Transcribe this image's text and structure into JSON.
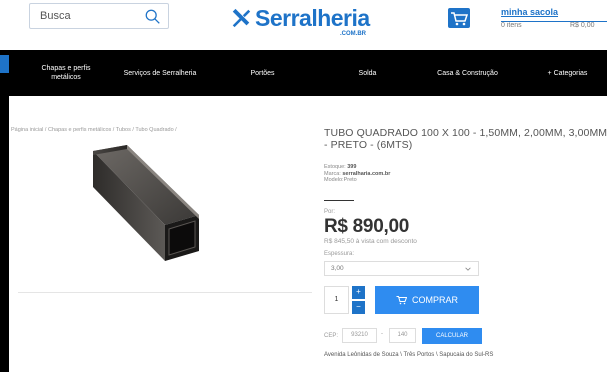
{
  "header": {
    "search_placeholder": "Busca",
    "logo_text": "Serralheria",
    "logo_domain": ".COM.BR",
    "bag_title": "minha sacola",
    "bag_items": "0 itens",
    "bag_total": "R$ 0,00"
  },
  "nav": {
    "items": [
      {
        "label": "Chapas e perfis metálicos"
      },
      {
        "label": "Serviços de Serralheria"
      },
      {
        "label": "Portões"
      },
      {
        "label": "Solda"
      },
      {
        "label": "Casa & Construção"
      },
      {
        "label": "+ Categorias"
      }
    ]
  },
  "breadcrumb": "Página inicial / Chapas e perfis metálicos / Tubos / Tubo Quadrado /",
  "product": {
    "title": "TUBO QUADRADO 100 X 100 - 1,50MM, 2,00MM, 3,00MM - PRETO - (6MTS)",
    "stock_label": "Estoque:",
    "stock_value": "399",
    "brand_label": "Marca:",
    "brand_value": "serralharia.com.br",
    "model_label": "Modelo:",
    "model_value": "Preto",
    "price_prefix": "Por:",
    "price": "R$ 890,00",
    "price_cash": "R$ 845,50 à vista com desconto",
    "thickness_label": "Espessura:",
    "thickness_value": "3,00",
    "quantity": "1",
    "plus_label": "+",
    "minus_label": "−",
    "buy_label": "COMPRAR"
  },
  "shipping": {
    "cep_label": "CEP:",
    "cep_part1": "93210",
    "cep_dash": "-",
    "cep_part2": "140",
    "calc_label": "CALCULAR",
    "address": "Avenida Leônidas de Souza \\ Três Portos \\ Sapucaia do Sul-RS"
  },
  "colors": {
    "brand_blue": "#1e73c8",
    "button_blue": "#2f8cf0",
    "nav_bg": "#000000"
  }
}
